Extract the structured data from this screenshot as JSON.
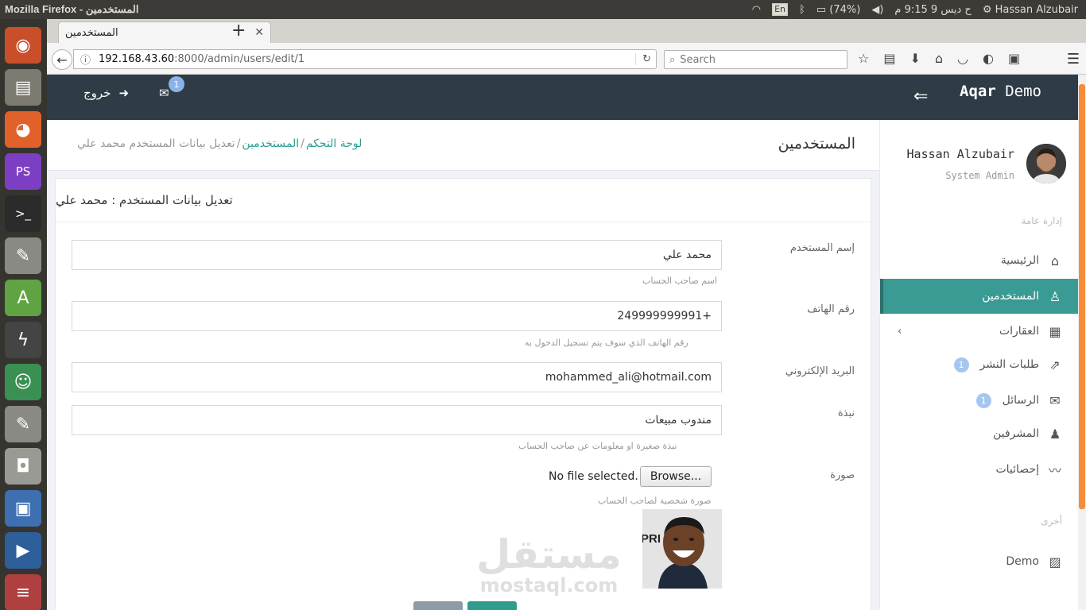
{
  "os": {
    "window_title": "Mozilla Firefox - المستخدمين",
    "keyboard_layout": "En",
    "battery": "(74%)",
    "clock": "ح ديس  9 9:15 م",
    "user": "Hassan Alzubair"
  },
  "launcher": [
    {
      "name": "ubuntu-dash-icon",
      "glyph": "◉",
      "bg": "#c94f2b"
    },
    {
      "name": "files-icon",
      "glyph": "▤",
      "bg": "#7d7a72"
    },
    {
      "name": "firefox-icon",
      "glyph": "◕",
      "bg": "#e0612a"
    },
    {
      "name": "phpstorm-icon",
      "glyph": "PS",
      "bg": "#7c3ec2"
    },
    {
      "name": "terminal-icon",
      "glyph": ">_",
      "bg": "#2b2b2b"
    },
    {
      "name": "text-editor-icon",
      "glyph": "✎",
      "bg": "#8a8a84"
    },
    {
      "name": "android-studio-icon",
      "glyph": "A",
      "bg": "#5fa343"
    },
    {
      "name": "bolt-app-icon",
      "glyph": "ϟ",
      "bg": "#444"
    },
    {
      "name": "game-icon",
      "glyph": "☺",
      "bg": "#3a8f52"
    },
    {
      "name": "text-editor-2-icon",
      "glyph": "✎",
      "bg": "#8a8a84"
    },
    {
      "name": "camera-icon",
      "glyph": "◘",
      "bg": "#9a9a94"
    },
    {
      "name": "virtualbox-icon",
      "glyph": "▣",
      "bg": "#3e6fb0"
    },
    {
      "name": "remote-desktop-icon",
      "glyph": "▶",
      "bg": "#2d5f9a"
    },
    {
      "name": "stacked-apps-icon",
      "glyph": "≡",
      "bg": "#b04040"
    }
  ],
  "browser": {
    "tab_title": "المستخدمين",
    "url_host": "192.168.43.60",
    "url_rest": ":8000/admin/users/edit/1",
    "search_placeholder": "Search"
  },
  "header": {
    "logout_label": "خروج",
    "mail_count": "1",
    "brand_bold": "Aqar",
    "brand_light": "Demo"
  },
  "page_head": {
    "title": "المستخدمين",
    "breadcrumb": {
      "home": "لوحة التحكم",
      "users": "المستخدمين",
      "current": "تعديل بيانات المستخدم محمد علي"
    }
  },
  "form": {
    "card_title": "تعديل بيانات المستخدم : محمد علي",
    "username_label": "إسم المستخدم",
    "username_value": "محمد علي",
    "username_help": "اسم صاحب الحساب",
    "phone_label": "رقم الهاتف",
    "phone_value": "249999999991+",
    "phone_help": "رقم الهاتف الذي سوف يتم تسجيل الدخول به",
    "email_label": "البريد الإلكتروني",
    "email_value": "mohammed_ali@hotmail.com",
    "bio_label": "نبذة",
    "bio_value": "مندوب مبيعات",
    "bio_help": "نبذة صغيرة او معلومات عن صاحب الحساب",
    "photo_label": "صورة",
    "file_button": "Browse...",
    "file_status": "No file selected.",
    "photo_help": "صورة شخصية لصاحب الحساب"
  },
  "watermark": {
    "arabic": "مستقل",
    "latin": "mostaql.com"
  },
  "sidebar": {
    "user_name": "Hassan Alzubair",
    "user_role": "System Admin",
    "section_general": "إدارة عامة",
    "section_other": "أخرى",
    "items": [
      {
        "label": "الرئيسية"
      },
      {
        "label": "المستخدمين"
      },
      {
        "label": "العقارات"
      },
      {
        "label": "طلبات النشر",
        "badge": "1"
      },
      {
        "label": "الرسائل",
        "badge": "1"
      },
      {
        "label": "المشرفين"
      },
      {
        "label": "إحصائيات"
      },
      {
        "label": "Demo"
      }
    ]
  }
}
